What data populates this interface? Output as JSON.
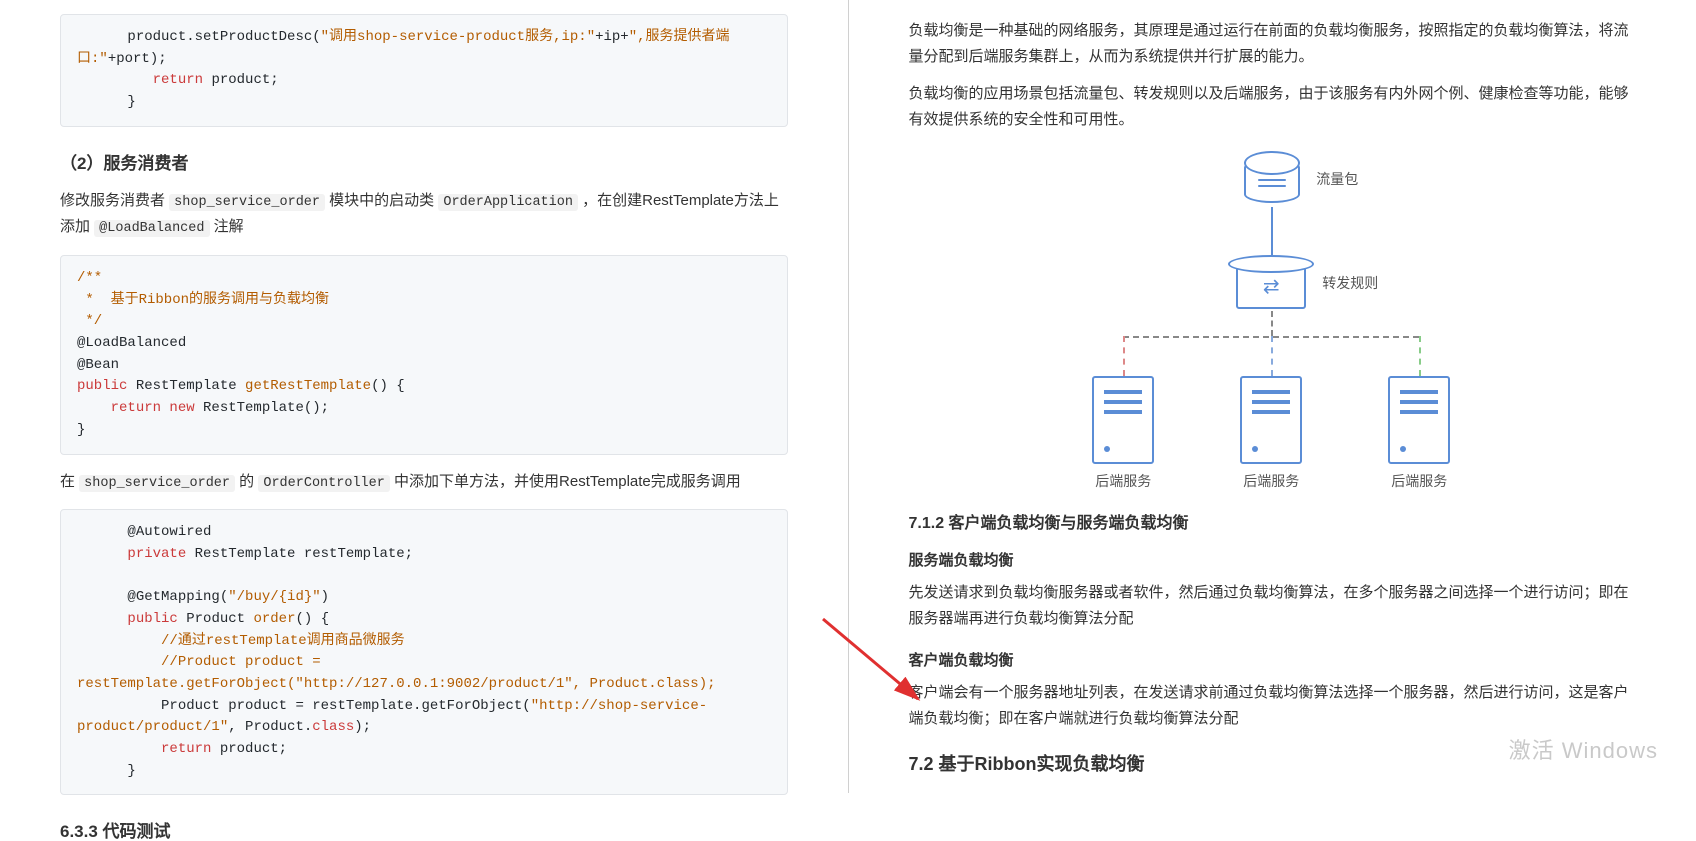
{
  "left": {
    "code1": {
      "l1a": "      product.setProductDesc(",
      "l1b": "\"调用shop-service-product服务,ip:\"",
      "l1c": "+ip+",
      "l1d": "\",服务提供者端口:\"",
      "l1e": "+port);",
      "l2a": "         ",
      "l2b": "return",
      "l2c": " product;",
      "l3": "      }"
    },
    "h_consumer": "（2）服务消费者",
    "p_consumer_a": "修改服务消费者 ",
    "p_consumer_b": "shop_service_order",
    "p_consumer_c": " 模块中的启动类 ",
    "p_consumer_d": "OrderApplication",
    "p_consumer_e": " ，在创建RestTemplate方法上添加 ",
    "p_consumer_f": "@LoadBalanced",
    "p_consumer_g": " 注解",
    "code2": {
      "l1": "/**",
      "l2": " *  基于Ribbon的服务调用与负载均衡",
      "l3": " */",
      "l4": "@LoadBalanced",
      "l5": "@Bean",
      "l6a": "public",
      "l6b": " RestTemplate ",
      "l6c": "getRestTemplate",
      "l6d": "() {",
      "l7a": "    ",
      "l7b": "return new",
      "l7c": " RestTemplate();",
      "l8": "}"
    },
    "p_ctrl_a": "在 ",
    "p_ctrl_b": "shop_service_order",
    "p_ctrl_c": " 的 ",
    "p_ctrl_d": "OrderController",
    "p_ctrl_e": " 中添加下单方法，并使用RestTemplate完成服务调用",
    "code3": {
      "l1": "      @Autowired",
      "l2a": "      ",
      "l2b": "private",
      "l2c": " RestTemplate restTemplate;",
      "blank": " ",
      "l3a": "      @GetMapping(",
      "l3b": "\"/buy/{id}\"",
      "l3c": ")",
      "l4a": "      ",
      "l4b": "public",
      "l4c": " Product ",
      "l4d": "order",
      "l4e": "() {",
      "l5": "          //通过restTemplate调用商品微服务",
      "l6": "          //Product product = restTemplate.getForObject(\"http://127.0.0.1:9002/product/1\", Product.class);",
      "l7a": "          Product product = restTemplate.getForObject(",
      "l7b": "\"http://shop-service-product/product/1\"",
      "l7c": ", Product.",
      "l7d": "class",
      "l7e": ");",
      "l8a": "          ",
      "l8b": "return",
      "l8c": " product;",
      "l9": "      }"
    },
    "h_633": "6.3.3 代码测试"
  },
  "right": {
    "p1": "负载均衡是一种基础的网络服务，其原理是通过运行在前面的负载均衡服务，按照指定的负载均衡算法，将流量分配到后端服务集群上，从而为系统提供并行扩展的能力。",
    "p2": "负载均衡的应用场景包括流量包、转发规则以及后端服务，由于该服务有内外网个例、健康检查等功能，能够有效提供系统的安全性和可用性。",
    "diag": {
      "traffic": "流量包",
      "rule": "转发规则",
      "backend": "后端服务"
    },
    "h_712": "7.1.2 客户端负载均衡与服务端负载均衡",
    "h_server_lb": "服务端负载均衡",
    "p_server_lb": "先发送请求到负载均衡服务器或者软件，然后通过负载均衡算法，在多个服务器之间选择一个进行访问；即在服务器端再进行负载均衡算法分配",
    "h_client_lb": "客户端负载均衡",
    "p_client_lb": "客户端会有一个服务器地址列表，在发送请求前通过负载均衡算法选择一个服务器，然后进行访问，这是客户端负载均衡；即在客户端就进行负载均衡算法分配",
    "h_72": "7.2 基于Ribbon实现负载均衡"
  },
  "watermark": "激活 Windows"
}
